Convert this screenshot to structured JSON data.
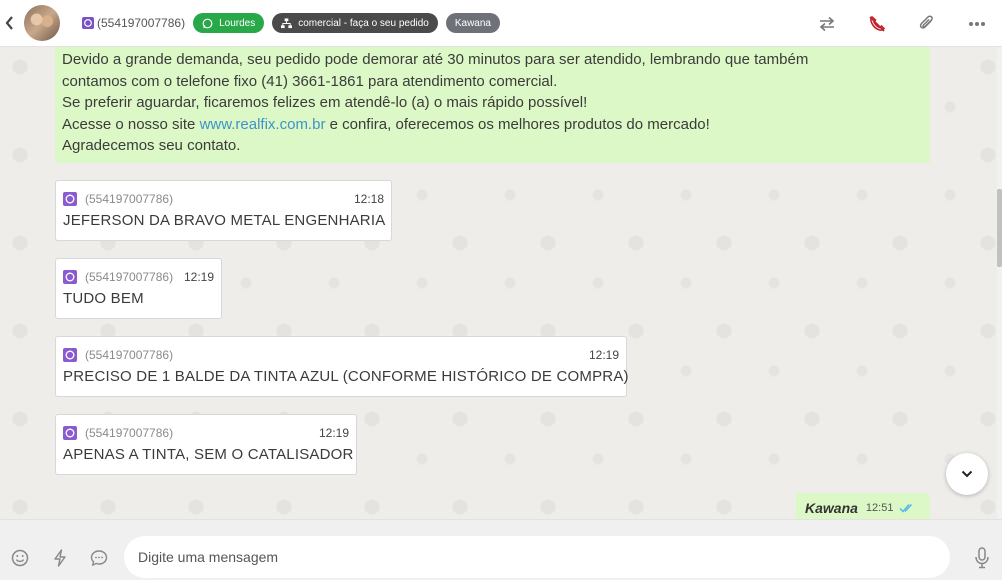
{
  "header": {
    "contact_number": "(554197007786)",
    "tags": [
      {
        "label": "Lourdes",
        "color": "#29a84a"
      },
      {
        "label": "comercial - faça o seu pedido",
        "color": "#4a4a4a"
      },
      {
        "label": "Kawana",
        "color": "#6e7278"
      }
    ]
  },
  "notice": {
    "line1": "Devido a grande demanda, seu pedido pode demorar até 30 minutos para ser atendido, lembrando que também",
    "line2": "contamos com o telefone fixo (41) 3661-1861 para atendimento comercial.",
    "line3": "Se preferir aguardar, ficaremos felizes em atendê-lo (a) o mais rápido possível!",
    "line4_before": "Acesse o nosso site ",
    "line4_link": "www.realfix.com.br",
    "line4_after": " e confira, oferecemos os melhores produtos do mercado!",
    "line5": "Agradecemos seu contato."
  },
  "messages": [
    {
      "sender": "(554197007786)",
      "time": "12:18",
      "text": "JEFERSON DA BRAVO METAL ENGENHARIA"
    },
    {
      "sender": "(554197007786)",
      "time": "12:19",
      "text": "TUDO BEM"
    },
    {
      "sender": "(554197007786)",
      "time": "12:19",
      "text": "PRECISO DE 1 BALDE DA TINTA AZUL (CONFORME HISTÓRICO DE COMPRA)"
    },
    {
      "sender": "(554197007786)",
      "time": "12:19",
      "text": "APENAS A TINTA, SEM O CATALISADOR"
    }
  ],
  "outgoing": {
    "name": "Kawana",
    "time": "12:51"
  },
  "composer": {
    "placeholder": "Digite uma mensagem"
  },
  "colors": {
    "accent_green": "#29a84a",
    "bubble_out": "#dcf8c6",
    "tick_blue": "#4fb6ec"
  }
}
